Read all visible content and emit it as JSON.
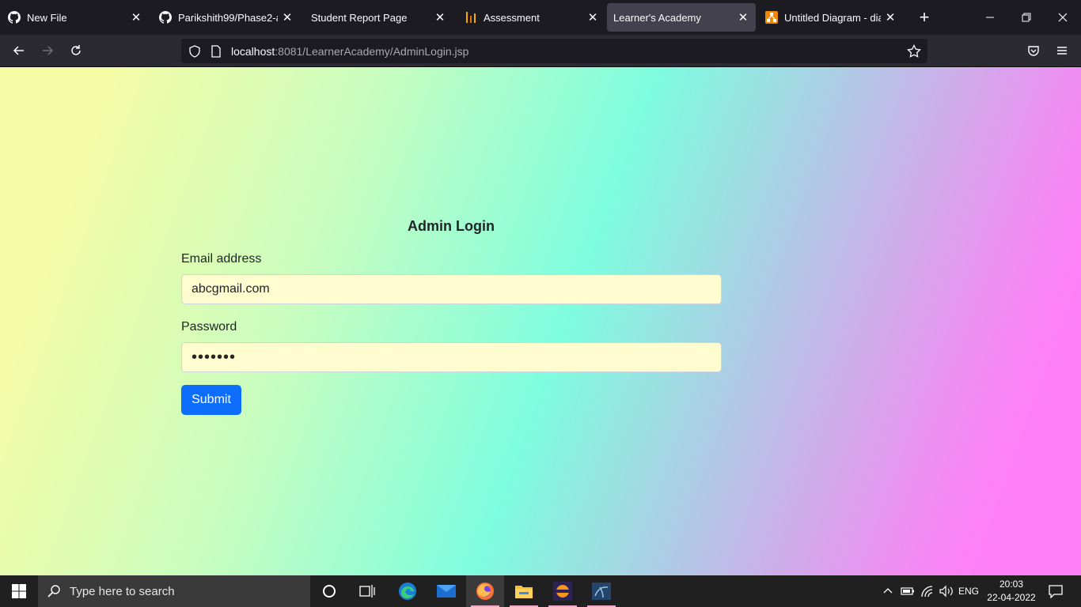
{
  "browser": {
    "tabs": [
      {
        "title": "New File",
        "icon": "github-icon"
      },
      {
        "title": "Parikshith99/Phase2-asse",
        "icon": "github-icon"
      },
      {
        "title": "Student Report Page",
        "icon": "none"
      },
      {
        "title": "Assessment",
        "icon": "bar-chart-icon"
      },
      {
        "title": "Learner's Academy",
        "icon": "none"
      },
      {
        "title": "Untitled Diagram - diagra",
        "icon": "drawio-icon"
      }
    ],
    "url_host": "localhost",
    "url_rest": ":8081/LearnerAcademy/AdminLogin.jsp"
  },
  "page": {
    "title": "Admin Login",
    "email_label": "Email address",
    "email_value": "abcgmail.com",
    "password_label": "Password",
    "password_value": "•••••••",
    "submit_label": "Submit"
  },
  "taskbar": {
    "search_placeholder": "Type here to search",
    "language": "ENG",
    "time": "20:03",
    "date": "22-04-2022"
  },
  "colors": {
    "submit": "#0d6efd",
    "field_bg": "#fffccf"
  }
}
